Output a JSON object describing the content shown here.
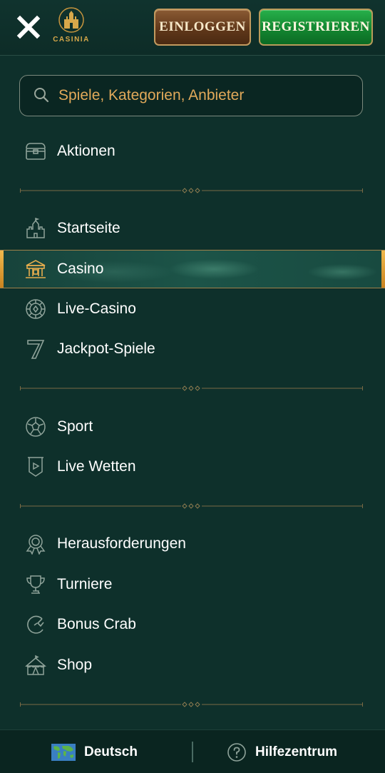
{
  "header": {
    "logo_text": "CASINIA",
    "login_label": "EINLOGGEN",
    "register_label": "REGISTRIEREN"
  },
  "search": {
    "placeholder": "Spiele, Kategorien, Anbieter"
  },
  "menu": {
    "promotions": {
      "label": "Aktionen",
      "icon": "treasure-chest-icon"
    },
    "home": {
      "label": "Startseite",
      "icon": "castle-icon"
    },
    "casino": {
      "label": "Casino",
      "icon": "casino-building-icon",
      "active": true
    },
    "live_casino": {
      "label": "Live-Casino",
      "icon": "chip-icon"
    },
    "jackpot": {
      "label": "Jackpot-Spiele",
      "icon": "seven-icon"
    },
    "sport": {
      "label": "Sport",
      "icon": "football-icon"
    },
    "live_bets": {
      "label": "Live Wetten",
      "icon": "banner-play-icon"
    },
    "challenges": {
      "label": "Herausforderungen",
      "icon": "award-ribbon-icon"
    },
    "tournaments": {
      "label": "Turniere",
      "icon": "trophy-icon"
    },
    "bonus_crab": {
      "label": "Bonus Crab",
      "icon": "claw-icon"
    },
    "shop": {
      "label": "Shop",
      "icon": "tent-icon"
    }
  },
  "footer": {
    "language_label": "Deutsch",
    "help_label": "Hilfezentrum"
  },
  "colors": {
    "background": "#0e302b",
    "accent_gold": "#e1a95a",
    "active_bar": "#f0b94d",
    "register_green": "#1a9a3b",
    "login_brown": "#6b4020"
  }
}
